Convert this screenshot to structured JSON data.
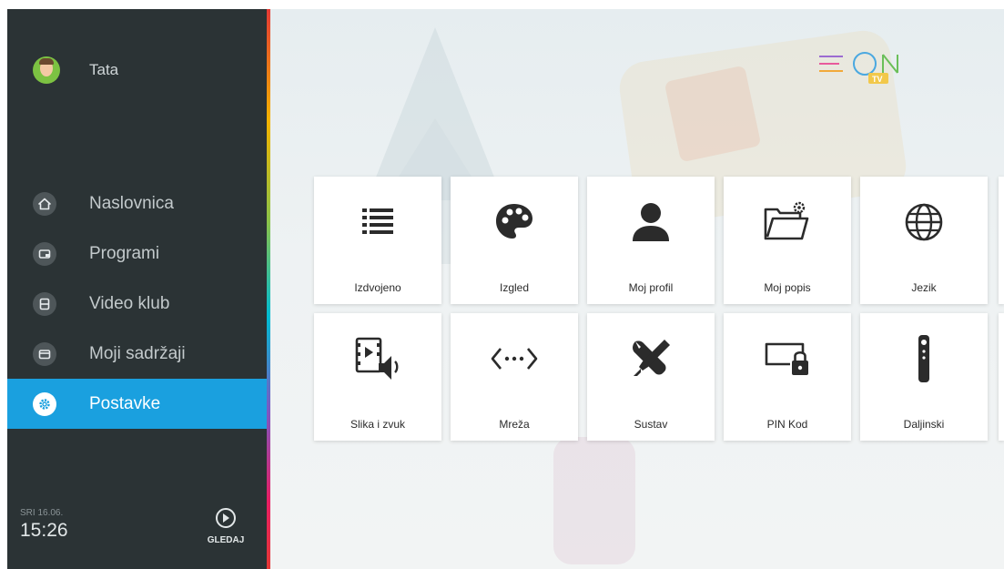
{
  "profile": {
    "name": "Tata"
  },
  "menu": {
    "items": [
      {
        "label": "Naslovnica",
        "icon": "home-icon"
      },
      {
        "label": "Programi",
        "icon": "tv-icon"
      },
      {
        "label": "Video klub",
        "icon": "film-icon"
      },
      {
        "label": "Moji sadržaji",
        "icon": "folder-icon"
      },
      {
        "label": "Postavke",
        "icon": "gear-icon",
        "active": true
      }
    ]
  },
  "footer": {
    "date": "SRI 16.06.",
    "time": "15:26",
    "watch_label": "GLEDAJ",
    "watch_icon": "play-circle-icon"
  },
  "logo": {
    "text": "EON",
    "sub": "TV"
  },
  "settings": {
    "tiles": [
      {
        "label": "Izdvojeno",
        "icon": "list-icon"
      },
      {
        "label": "Izgled",
        "icon": "palette-icon"
      },
      {
        "label": "Moj profil",
        "icon": "person-icon"
      },
      {
        "label": "Moj popis",
        "icon": "folder-gear-icon"
      },
      {
        "label": "Jezik",
        "icon": "globe-icon"
      },
      {
        "label": "Slika i zvuk",
        "icon": "video-sound-icon"
      },
      {
        "label": "Mreža",
        "icon": "network-icon"
      },
      {
        "label": "Sustav",
        "icon": "tools-icon"
      },
      {
        "label": "PIN Kod",
        "icon": "screen-lock-icon"
      },
      {
        "label": "Daljinski",
        "icon": "remote-icon"
      }
    ]
  },
  "colors": {
    "sidebar": "#2b3335",
    "accent": "#1aa0df",
    "tile": "#ffffff"
  }
}
